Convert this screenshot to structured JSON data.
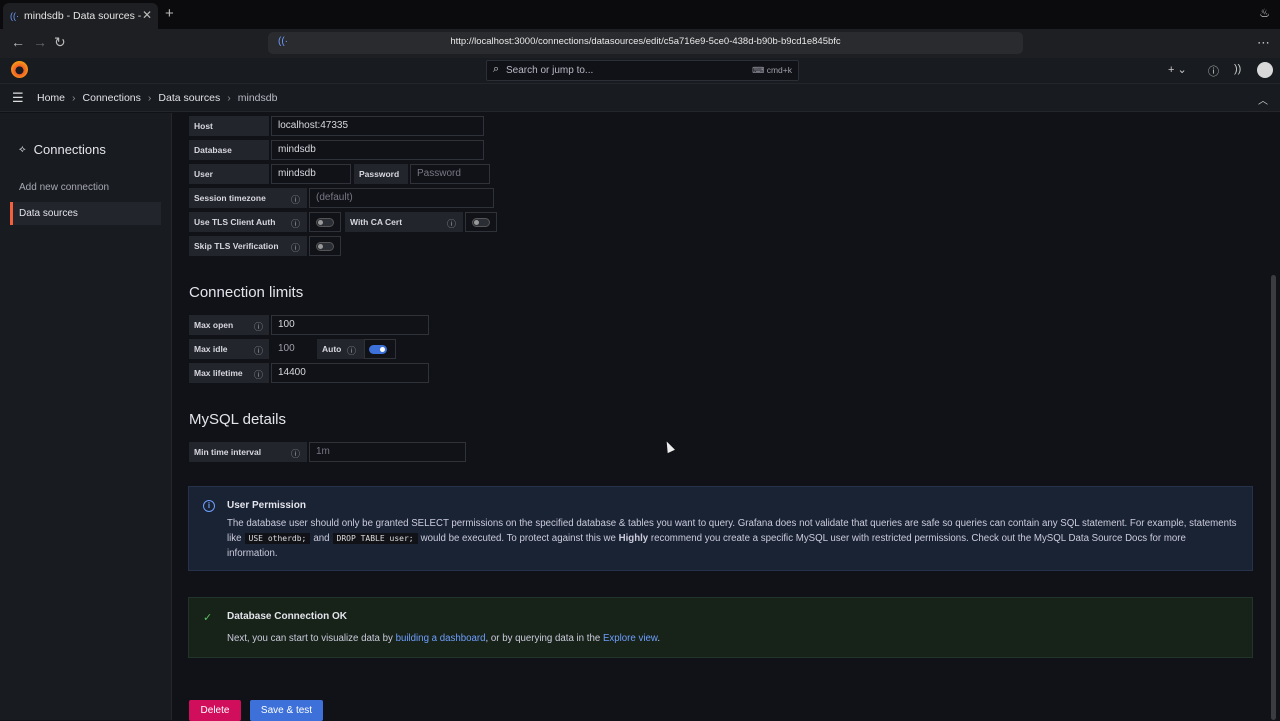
{
  "browser": {
    "tab_title": "mindsdb - Data sources - Con",
    "url": "http://localhost:3000/connections/datasources/edit/c5a716e9-5ce0-438d-b90b-b9cd1e845bfc"
  },
  "topnav": {
    "search_placeholder": "Search or jump to...",
    "search_shortcut": "cmd+k"
  },
  "breadcrumb": [
    "Home",
    "Connections",
    "Data sources",
    "mindsdb"
  ],
  "sidebar": {
    "title": "Connections",
    "items": [
      "Add new connection",
      "Data sources"
    ]
  },
  "connection": {
    "host_label": "Host",
    "host_value": "localhost:47335",
    "database_label": "Database",
    "database_value": "mindsdb",
    "user_label": "User",
    "user_value": "mindsdb",
    "password_label": "Password",
    "password_placeholder": "Password",
    "timezone_label": "Session timezone",
    "timezone_placeholder": "(default)",
    "tls_label": "Use TLS Client Auth",
    "ca_label": "With CA Cert",
    "skip_tls_label": "Skip TLS Verification"
  },
  "limits": {
    "heading": "Connection limits",
    "max_open_label": "Max open",
    "max_open_value": "100",
    "max_idle_label": "Max idle",
    "max_idle_value": "100",
    "auto_label": "Auto",
    "max_lifetime_label": "Max lifetime",
    "max_lifetime_value": "14400"
  },
  "mysql": {
    "heading": "MySQL details",
    "min_interval_label": "Min time interval",
    "min_interval_placeholder": "1m"
  },
  "permission": {
    "title": "User Permission",
    "text1": "The database user should only be granted SELECT permissions on the specified database & tables you want to query. Grafana does not validate that queries are safe so queries can contain any SQL statement. For example, statements like",
    "code1": "USE otherdb;",
    "and": "and",
    "code2": "DROP TABLE user;",
    "text2": "would be executed. To protect against this we",
    "highly": "Highly",
    "text3": "recommend you create a specific MySQL user with restricted permissions. Check out the MySQL Data Source Docs for more information."
  },
  "status": {
    "title": "Database Connection OK",
    "text1": "Next, you can start to visualize data by",
    "link1": "building a dashboard",
    "text2": ", or by querying data in the",
    "link2": "Explore view",
    "text3": "."
  },
  "buttons": {
    "delete": "Delete",
    "save": "Save & test"
  },
  "colors": {
    "accent": "#3d71d9",
    "danger": "#d10e5c",
    "success": "#5ac05f",
    "brand": "#f05a28"
  }
}
